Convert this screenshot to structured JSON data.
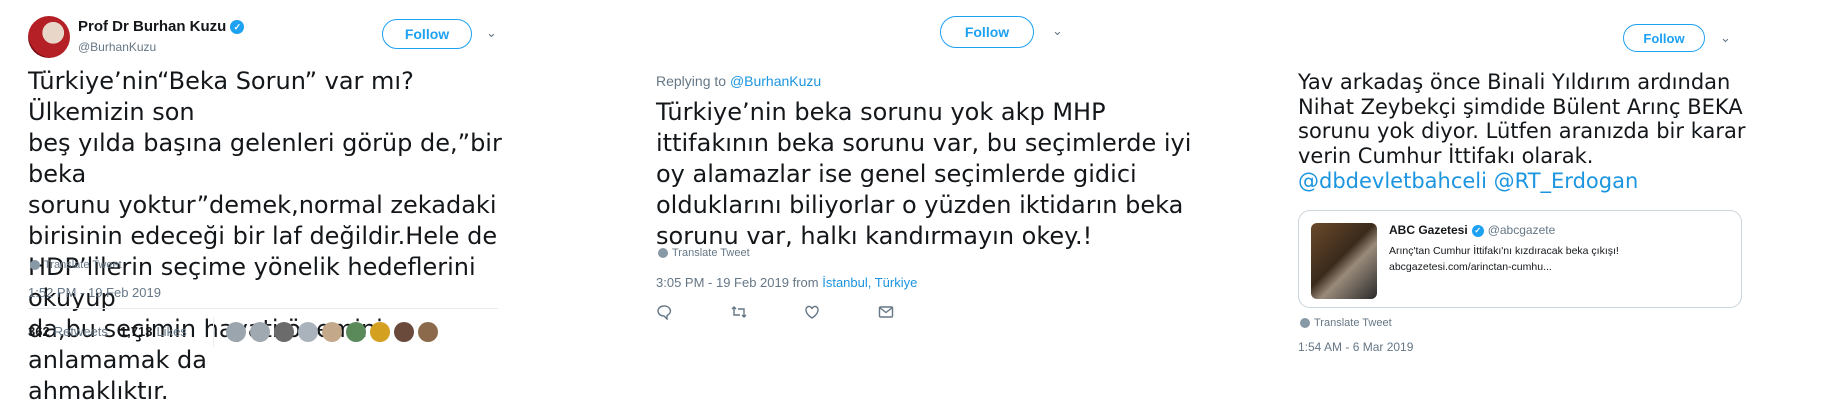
{
  "tweet1": {
    "author_name": "Prof Dr Burhan Kuzu",
    "handle": "@BurhanKuzu",
    "follow_label": "Follow",
    "text": "Türkiye’nin“Beka Sorun” var mı?Ülkemizin son\nbeş yılda başına gelenleri görüp de,”bir beka\nsorunu yoktur”demek,normal zekadaki\nbirisinin edeceği bir laf değildir.Hele de\nHDP’lilerin seçime yönelik hedeflerini okuyup\nda,bu seçimin hayati önemini anlamamak da\nahmaklıktır.",
    "translate": "Translate Tweet",
    "timestamp": "1:52 PM - 19 Feb 2019",
    "retweets_count": "362",
    "retweets_label": "Retweets",
    "likes_count": "1,713",
    "likes_label": "Likes",
    "liker_colors": [
      "#9aa5ae",
      "#a0a8b0",
      "#6b6b6b",
      "#aab3bb",
      "#c4a88a",
      "#5a8a5a",
      "#d4a020",
      "#6a4a3a",
      "#8a6a4a"
    ]
  },
  "tweet2": {
    "follow_label": "Follow",
    "replying_prefix": "Replying to",
    "replying_handle": "@BurhanKuzu",
    "text": "Türkiye’nin beka sorunu yok akp MHP\nittifakının beka sorunu var, bu seçimlerde iyi\noy alamazlar ise genel seçimlerde gidici\nolduklarını biliyorlar o yüzden iktidarın beka\nsorunu var, halkı kandırmayın okey.!",
    "translate": "Translate Tweet",
    "timestamp": "3:05 PM - 19 Feb 2019 from",
    "location": "İstanbul, Türkiye"
  },
  "tweet3": {
    "follow_label": "Follow",
    "text": "Yav arkadaş önce Binali Yıldırım ardından\nNihat Zeybekçi şimdide Bülent Arınç BEKA\nsorunu yok diyor. Lütfen aranızda bir karar\nverin Cumhur İttifakı olarak.",
    "mentions": "@dbdevletbahceli @RT_Erdogan",
    "quote": {
      "name": "ABC Gazetesi",
      "handle": "@abcgazete",
      "line1": "Arınç'tan Cumhur İttifakı'nı kızdıracak beka çıkışı!",
      "line2": "abcgazetesi.com/arinctan-cumhu..."
    },
    "translate": "Translate Tweet",
    "timestamp": "1:54 AM - 6 Mar 2019"
  },
  "icons": {
    "reply": "reply-icon",
    "retweet": "retweet-icon",
    "like": "heart-icon",
    "dm": "envelope-icon",
    "chevron": "chevron-down-icon",
    "globe": "globe-icon",
    "verified": "verified-badge-icon"
  },
  "colors": {
    "accent": "#1da1f2",
    "link": "#1b95e0",
    "muted": "#657786",
    "text": "#14171a"
  }
}
